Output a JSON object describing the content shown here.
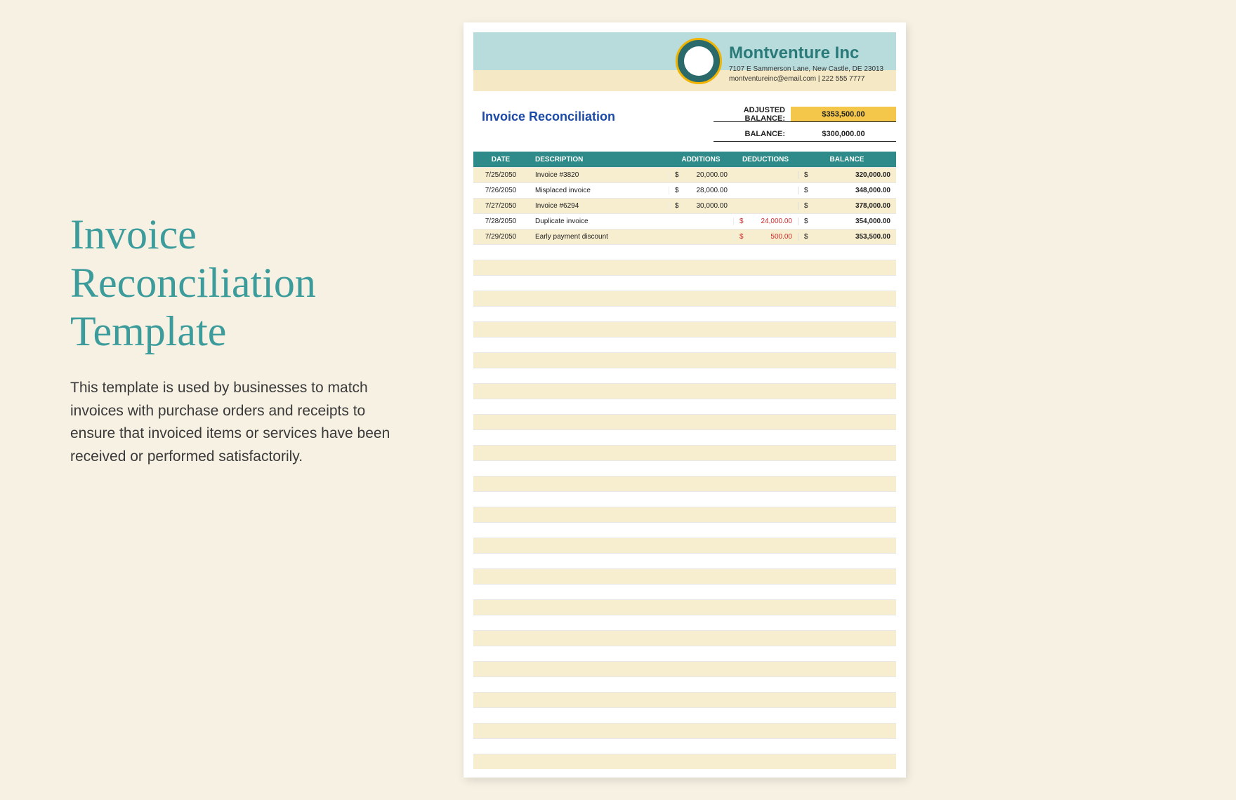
{
  "left": {
    "title": "Invoice Reconciliation Template",
    "desc": "This template is used by businesses to match invoices with purchase orders and receipts to ensure that invoiced items or services have been received or performed satisfactorily."
  },
  "doc": {
    "company_name": "Montventure Inc",
    "company_addr": "7107 E Sammerson Lane, New Castle, DE 23013",
    "company_contact": "montventureinc@email.com | 222 555 7777",
    "title": "Invoice Reconciliation",
    "adj_balance_label": "ADJUSTED BALANCE:",
    "adj_balance_value": "$353,500.00",
    "balance_label": "BALANCE:",
    "balance_value": "$300,000.00",
    "cols": {
      "date": "DATE",
      "desc": "DESCRIPTION",
      "add": "ADDITIONS",
      "ded": "DEDUCTIONS",
      "bal": "BALANCE"
    },
    "currency": "$",
    "rows": [
      {
        "date": "7/25/2050",
        "desc": "Invoice #3820",
        "add": "20,000.00",
        "ded": "",
        "bal": "320,000.00"
      },
      {
        "date": "7/26/2050",
        "desc": "Misplaced invoice",
        "add": "28,000.00",
        "ded": "",
        "bal": "348,000.00"
      },
      {
        "date": "7/27/2050",
        "desc": "Invoice #6294",
        "add": "30,000.00",
        "ded": "",
        "bal": "378,000.00"
      },
      {
        "date": "7/28/2050",
        "desc": "Duplicate invoice",
        "add": "",
        "ded": "24,000.00",
        "bal": "354,000.00"
      },
      {
        "date": "7/29/2050",
        "desc": "Early payment discount",
        "add": "",
        "ded": "500.00",
        "bal": "353,500.00"
      }
    ],
    "empty_rows": 34
  }
}
